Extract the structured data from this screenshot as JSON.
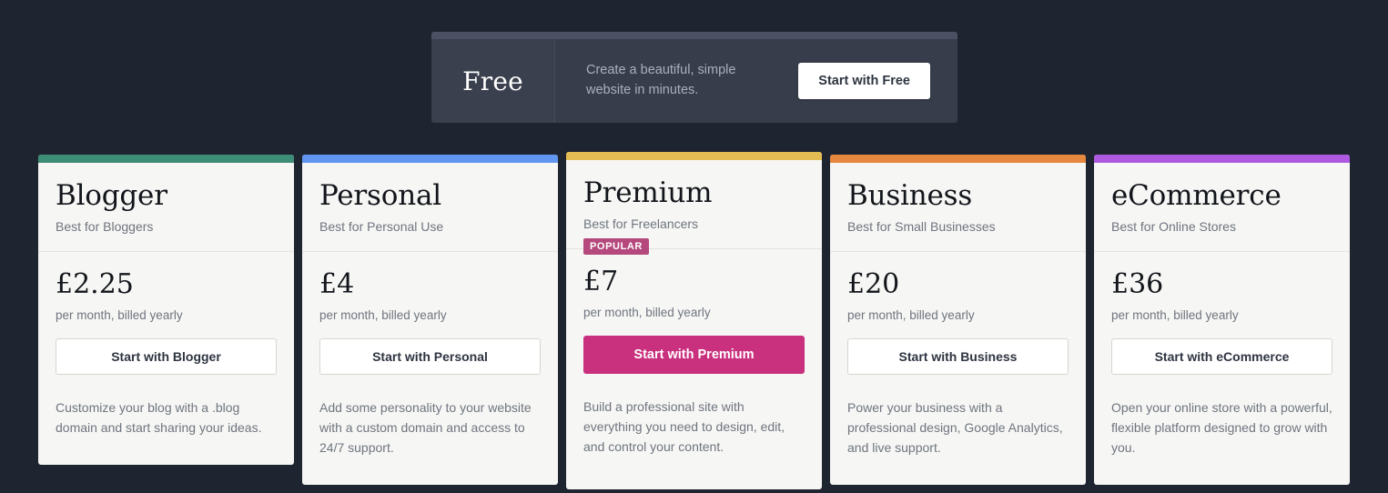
{
  "theme": {
    "page_background": "#1e2430",
    "card_background": "#f6f6f4",
    "accent_popular": "#c9307e",
    "badge_color": "#b5497d"
  },
  "free_plan": {
    "name": "Free",
    "description": "Create a beautiful, simple website in minutes.",
    "cta_label": "Start with Free"
  },
  "plans": [
    {
      "name": "Blogger",
      "tagline": "Best for Bloggers",
      "accent_color": "#3e8d77",
      "price": "£2.25",
      "price_note": "per month, billed yearly",
      "cta_label": "Start with Blogger",
      "description": "Customize your blog with a .blog domain and start sharing your ideas.",
      "badge": "",
      "featured": false
    },
    {
      "name": "Personal",
      "tagline": "Best for Personal Use",
      "accent_color": "#6195f0",
      "price": "£4",
      "price_note": "per month, billed yearly",
      "cta_label": "Start with Personal",
      "description": "Add some personality to your website with a custom domain and access to 24/7 support.",
      "badge": "",
      "featured": false
    },
    {
      "name": "Premium",
      "tagline": "Best for Freelancers",
      "accent_color": "#e4bc54",
      "price": "£7",
      "price_note": "per month, billed yearly",
      "cta_label": "Start with Premium",
      "description": "Build a professional site with everything you need to design, edit, and control your content.",
      "badge": "POPULAR",
      "featured": true
    },
    {
      "name": "Business",
      "tagline": "Best for Small Businesses",
      "accent_color": "#e5873c",
      "price": "£20",
      "price_note": "per month, billed yearly",
      "cta_label": "Start with Business",
      "description": "Power your business with a professional design, Google Analytics, and live support.",
      "badge": "",
      "featured": false
    },
    {
      "name": "eCommerce",
      "tagline": "Best for Online Stores",
      "accent_color": "#ad5ae0",
      "price": "£36",
      "price_note": "per month, billed yearly",
      "cta_label": "Start with eCommerce",
      "description": "Open your online store with a powerful, flexible platform designed to grow with you.",
      "badge": "",
      "featured": false
    }
  ]
}
